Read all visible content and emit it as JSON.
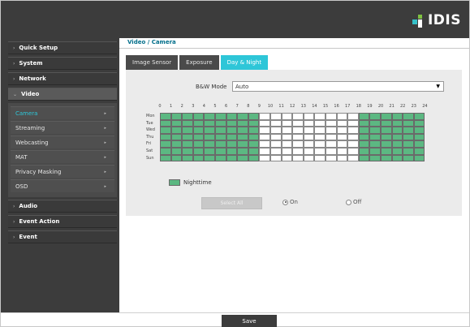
{
  "brand": {
    "logo_text": "IDIS"
  },
  "breadcrumb": "Video / Camera",
  "sidebar": {
    "top_items": [
      {
        "label": "Quick Setup"
      },
      {
        "label": "System"
      },
      {
        "label": "Network"
      }
    ],
    "open_item": {
      "label": "Video"
    },
    "sub_items": [
      {
        "label": "Camera",
        "active": true
      },
      {
        "label": "Streaming"
      },
      {
        "label": "Webcasting"
      },
      {
        "label": "MAT"
      },
      {
        "label": "Privacy Masking"
      },
      {
        "label": "OSD"
      }
    ],
    "bottom_items": [
      {
        "label": "Audio"
      },
      {
        "label": "Event Action"
      },
      {
        "label": "Event"
      }
    ]
  },
  "tabs": [
    {
      "label": "Image Sensor"
    },
    {
      "label": "Exposure"
    },
    {
      "label": "Day & Night",
      "active": true
    }
  ],
  "bw_mode": {
    "label": "B&W Mode",
    "value": "Auto"
  },
  "schedule": {
    "hours": [
      "0",
      "1",
      "2",
      "3",
      "4",
      "5",
      "6",
      "7",
      "8",
      "9",
      "10",
      "11",
      "12",
      "13",
      "14",
      "15",
      "16",
      "17",
      "18",
      "19",
      "20",
      "21",
      "22",
      "23",
      "24"
    ],
    "days": [
      "Mon",
      "Tue",
      "Wed",
      "Thu",
      "Fri",
      "Sat",
      "Sun"
    ],
    "night_hours": [
      0,
      1,
      2,
      3,
      4,
      5,
      6,
      7,
      8,
      18,
      19,
      20,
      21,
      22,
      23
    ]
  },
  "legend": {
    "label": "Nighttime",
    "color": "#5cb882"
  },
  "select_all_label": "Select All",
  "radio_on_label": "On",
  "radio_off_label": "Off",
  "save_label": "Save",
  "colors": {
    "accent": "#2ec6d8",
    "dark": "#3c3c3c",
    "nighttime": "#5cb882"
  }
}
